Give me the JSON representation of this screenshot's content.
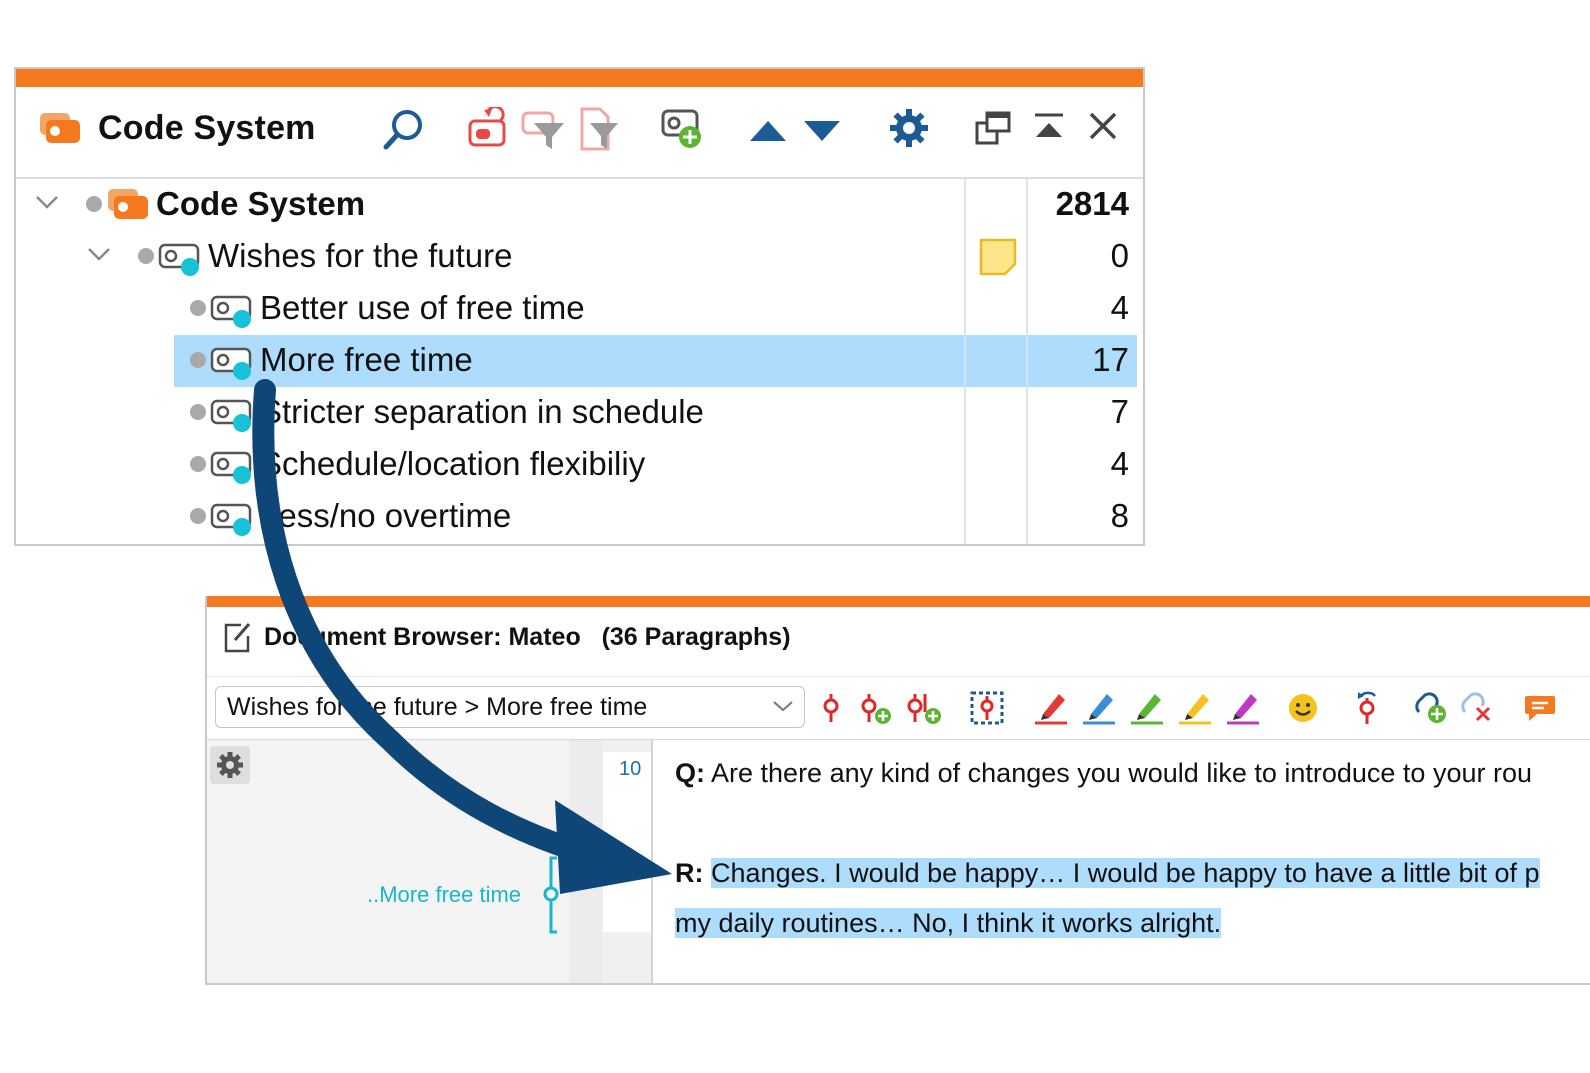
{
  "code_system": {
    "title": "Code System",
    "rows": [
      {
        "label": "Code System",
        "count": "2814"
      },
      {
        "label": "Wishes for the future",
        "count": "0"
      },
      {
        "label": "Better use of free time",
        "count": "4"
      },
      {
        "label": "More free time",
        "count": "17"
      },
      {
        "label": "Stricter separation in schedule",
        "count": "7"
      },
      {
        "label": "Schedule/location flexibiliy",
        "count": "4"
      },
      {
        "label": "Less/no overtime",
        "count": "8"
      }
    ],
    "toolbar_icons": [
      "code-system-icon",
      "search-icon",
      "activate-codes-icon",
      "filter-code-icon",
      "filter-document-icon",
      "new-code-icon",
      "move-up-icon",
      "move-down-icon",
      "settings-icon",
      "undock-icon",
      "collapse-icon",
      "close-icon"
    ],
    "colors": {
      "accent": "#f5791f",
      "selection": "#aedcfc",
      "code_dot": "#17c1d6",
      "memo": "#fde68a"
    }
  },
  "document_browser": {
    "title": "Document Browser: Mateo",
    "paragraph_count": "(36 Paragraphs)",
    "code_selector": "Wishes for the future > More free time",
    "paragraph_number": "10",
    "coding_stripe_label": "..More free time",
    "question_label": "Q:",
    "question_text": "Are there any kind of changes you would like to introduce to your rou",
    "answer_label": "R:",
    "answer_text_line1": "Changes. I would be happy… I would be happy to have a little bit of p",
    "answer_text_line2": "my daily routines… No, I think it works alright.",
    "toolbar_icons": [
      "code-icon",
      "code-new-icon",
      "code-recent-icon",
      "code-selection-icon",
      "highlight-red-icon",
      "highlight-blue-icon",
      "highlight-green-icon",
      "highlight-yellow-icon",
      "highlight-magenta-icon",
      "emoticode-icon",
      "undo-code-icon",
      "link-add-icon",
      "link-remove-icon",
      "comment-icon"
    ]
  }
}
